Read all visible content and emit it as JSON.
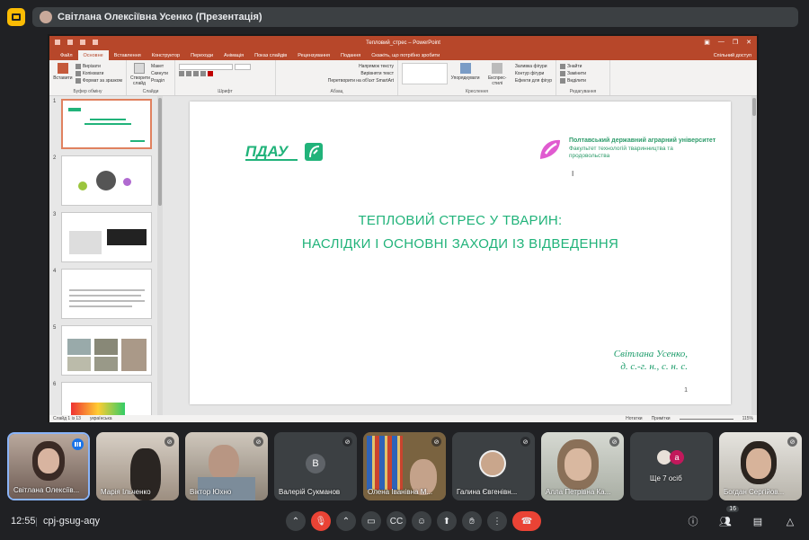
{
  "meet": {
    "presenter_chip": "Світлана Олексіївна Усенко (Презентація)",
    "time": "12:55",
    "meeting_code": "cpj-gsug-aqy",
    "people_count": "16"
  },
  "ppt": {
    "window_title": "Тепловий_стрес – PowerPoint",
    "menu": [
      "Файл",
      "Основне",
      "Вставлення",
      "Конструктор",
      "Переходи",
      "Анімація",
      "Показ слайдів",
      "Рецензування",
      "Подання",
      "Скажіть, що потрібно зробити"
    ],
    "share": "Спільний доступ",
    "ribbon": {
      "paste": "Вставити",
      "cut": "Вирізати",
      "copy": "Копіювати",
      "format_painter": "Формат за зразком",
      "clipboard": "Буфер обміну",
      "new_slide": "Створити слайд",
      "layout": "Макет",
      "reset": "Скинути",
      "section": "Розділ",
      "slides": "Слайди",
      "font": "Шрифт",
      "text_dir": "Напрямок тексту",
      "align_text": "Вирівняти текст",
      "smartart": "Перетворити на об'єкт SmartArt",
      "paragraph": "Абзац",
      "arrange": "Упорядкувати",
      "quick_styles": "Експрес-стилі",
      "shape_fill": "Заливка фігури",
      "shape_outline": "Контур фігури",
      "shape_effects": "Ефекти для фігур",
      "drawing": "Креслення",
      "find": "Знайти",
      "replace": "Замінити",
      "select": "Виділити",
      "editing": "Редагування"
    },
    "thumb_numbers": [
      "1",
      "2",
      "3",
      "4",
      "5",
      "6"
    ],
    "status_left": "Слайд 1 із 13",
    "status_lang": "українська",
    "notes": "Нотатки",
    "comments": "Примітки",
    "zoom": "115%"
  },
  "slide": {
    "logo_text": "ПДАУ",
    "uni_name": "Полтавський державний аграрний університет",
    "faculty": "Факультет технологій тваринництва та продовольства",
    "title_line1": "ТЕПЛОВИЙ СТРЕС У ТВАРИН:",
    "title_line2": "НАСЛІДКИ І ОСНОВНІ ЗАХОДИ ІЗ ВІДВЕДЕННЯ",
    "author_name": "Світлана Усенко,",
    "author_degree": "д. с.-г. н., с. н. с.",
    "page_number": "1"
  },
  "participants": [
    {
      "name": "Світлана Олексіїв...",
      "speaking": true
    },
    {
      "name": "Марія Ільченко",
      "muted": true
    },
    {
      "name": "Віктор Юхно",
      "muted": true
    },
    {
      "name": "Валерій Сукманов",
      "muted": true,
      "initial": "В"
    },
    {
      "name": "Олена Іванівна М...",
      "muted": true
    },
    {
      "name": "Галина Євгенівн...",
      "muted": true
    },
    {
      "name": "Алла Петрівна Ка...",
      "muted": true
    },
    {
      "name": "Ще 7 осіб",
      "initial": "a"
    },
    {
      "name": "Богдан Сергійов...",
      "muted": true
    }
  ],
  "colors": {
    "ppt_red": "#b7472a",
    "slide_green": "#21b37a",
    "accent_pink": "#e05bd0",
    "meet_bg": "#202124",
    "end_call": "#ea4335"
  }
}
